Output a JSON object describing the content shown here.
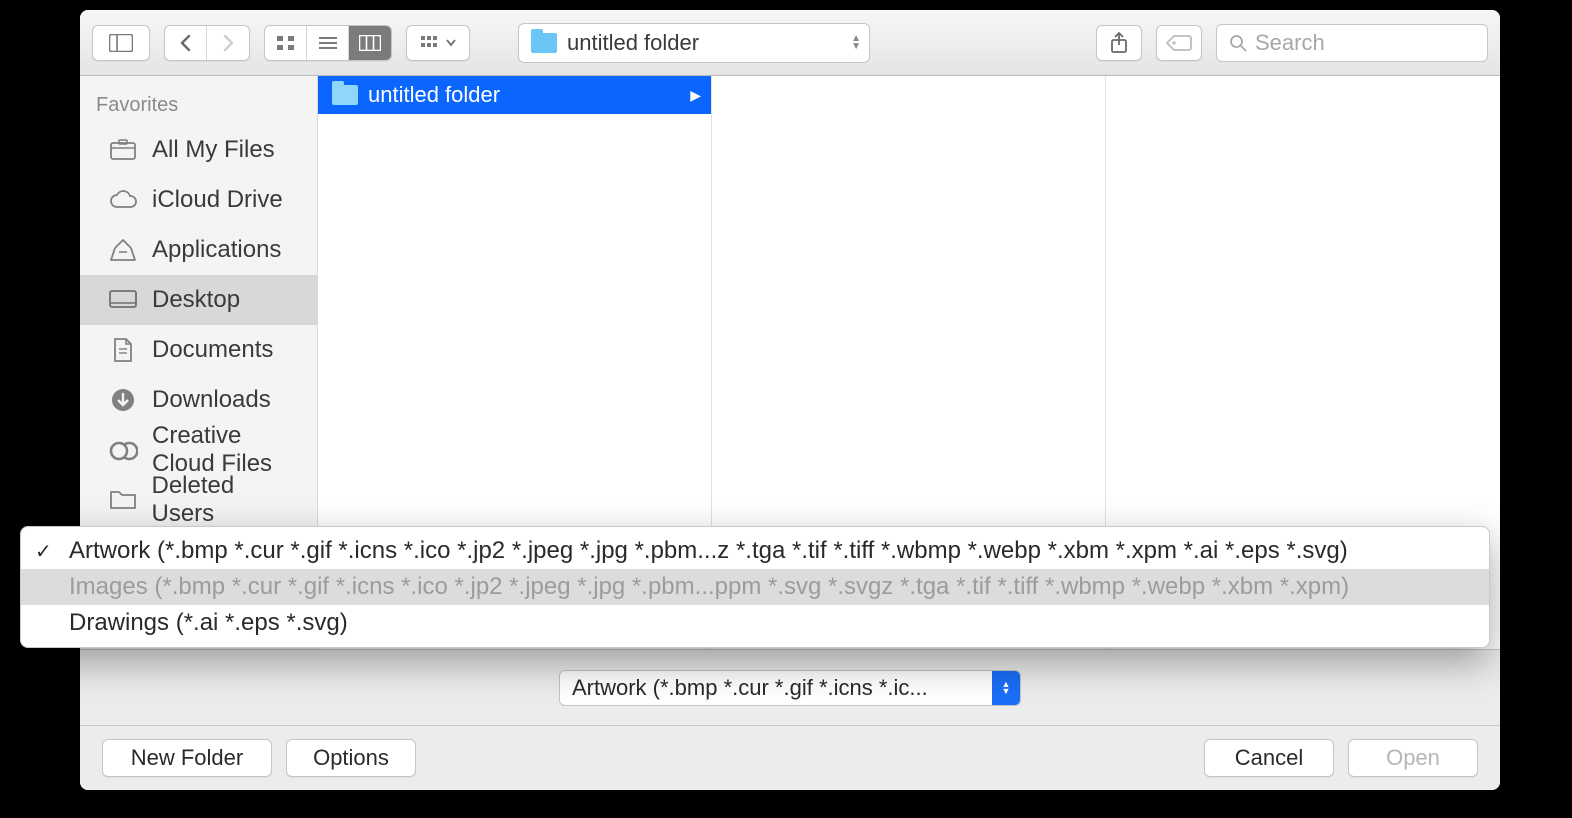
{
  "toolbar": {
    "path_label": "untitled folder",
    "search_placeholder": "Search"
  },
  "sidebar": {
    "header": "Favorites",
    "items": [
      {
        "label": "All My Files"
      },
      {
        "label": "iCloud Drive"
      },
      {
        "label": "Applications"
      },
      {
        "label": "Desktop"
      },
      {
        "label": "Documents"
      },
      {
        "label": "Downloads"
      },
      {
        "label": "Creative Cloud Files"
      },
      {
        "label": "Deleted Users"
      }
    ]
  },
  "column": {
    "row0": "untitled folder"
  },
  "type_select": {
    "label": "Artwork (*.bmp *.cur *.gif *.icns *.ic..."
  },
  "popup": {
    "items": [
      "Artwork (*.bmp *.cur *.gif *.icns *.ico *.jp2 *.jpeg *.jpg *.pbm...z *.tga *.tif *.tiff *.wbmp *.webp *.xbm *.xpm *.ai *.eps *.svg)",
      "Images (*.bmp *.cur *.gif *.icns *.ico *.jp2 *.jpeg *.jpg *.pbm...ppm *.svg *.svgz *.tga *.tif *.tiff *.wbmp *.webp *.xbm *.xpm)",
      "Drawings (*.ai *.eps *.svg)"
    ]
  },
  "footer": {
    "new_folder": "New Folder",
    "options": "Options",
    "cancel": "Cancel",
    "open": "Open"
  }
}
